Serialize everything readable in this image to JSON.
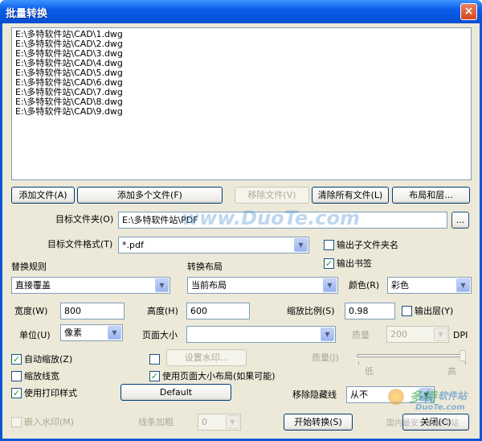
{
  "window": {
    "title": "批量转换",
    "close": "×"
  },
  "files": [
    "E:\\多特软件站\\CAD\\1.dwg",
    "E:\\多特软件站\\CAD\\2.dwg",
    "E:\\多特软件站\\CAD\\3.dwg",
    "E:\\多特软件站\\CAD\\4.dwg",
    "E:\\多特软件站\\CAD\\5.dwg",
    "E:\\多特软件站\\CAD\\6.dwg",
    "E:\\多特软件站\\CAD\\7.dwg",
    "E:\\多特软件站\\CAD\\8.dwg",
    "E:\\多特软件站\\CAD\\9.dwg"
  ],
  "buttons": {
    "add_file": "添加文件(A)",
    "add_multi": "添加多个文件(F)",
    "remove_file": "移除文件(V)",
    "clear_all": "清除所有文件(L)",
    "layout_layers": "布局和层...",
    "browse": "...",
    "set_watermark": "设置水印...",
    "default": "Default",
    "start": "开始转换(S)",
    "close": "关闭(C)"
  },
  "target": {
    "folder_label": "目标文件夹(O)",
    "folder_value": "E:\\多特软件站\\PDF",
    "format_label": "目标文件格式(T)",
    "format_value": "*.pdf",
    "subfolder_label": "输出子文件夹名",
    "bookmark_label": "输出书签"
  },
  "rules": {
    "replace_label": "替换规则",
    "replace_value": "直接覆盖",
    "layout_label": "转换布局",
    "layout_value": "当前布局",
    "color_label": "颜色(R)",
    "color_value": "彩色"
  },
  "size": {
    "width_label": "宽度(W)",
    "width_value": "800",
    "height_label": "高度(H)",
    "height_value": "600",
    "scale_label": "缩放比例(S)",
    "scale_value": "0.98",
    "output_layer_label": "输出层(Y)",
    "unit_label": "单位(U)",
    "unit_value": "像素",
    "page_size_label": "页面大小",
    "page_size_value": "",
    "quality_label": "质量",
    "quality_value": "200",
    "dpi_label": "DPI"
  },
  "options": {
    "auto_zoom": "自动缩放(Z)",
    "zoom_linewidth": "缩放线宽",
    "use_print_style": "使用打印样式",
    "use_page_size_layout": "使用页面大小布局(如果可能)",
    "quality_j_label": "质量(J)",
    "low": "低",
    "high": "高",
    "remove_hidden_label": "移除隐藏线",
    "remove_hidden_value": "从不",
    "embed_watermark": "嵌入水印(M)",
    "line_bold_label": "线条加粗",
    "line_bold_value": "0"
  },
  "watermark": {
    "site": "www.DuoTe.com",
    "logo_main": "多特",
    "logo_sub": "软件站",
    "logo_url": "DuoTe.com",
    "logo_slogan": "国内最安全的软件站"
  },
  "colors": {
    "titlebar": "#0b5ee9",
    "dialog_bg": "#ece9d8",
    "check": "#21a121"
  }
}
